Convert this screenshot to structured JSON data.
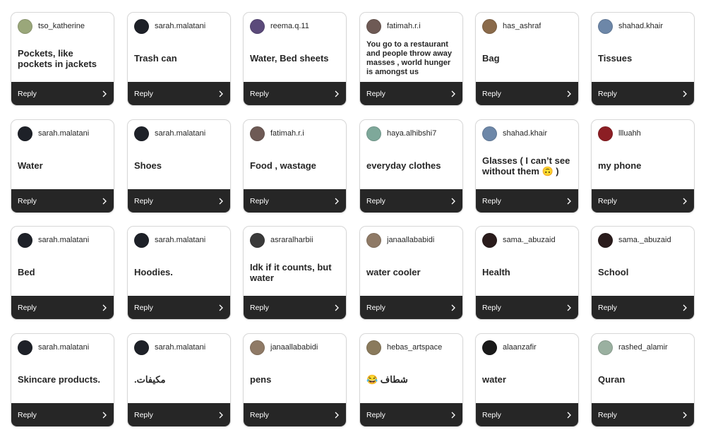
{
  "reply_label": "Reply",
  "cards": [
    {
      "user": "tso_katherine",
      "answer": "Pockets, like pockets in jackets",
      "avatar_color": "#9aa77a"
    },
    {
      "user": "sarah.malatani",
      "answer": "Trash can",
      "avatar_color": "#1e2128"
    },
    {
      "user": "reema.q.11",
      "answer": "Water, Bed sheets",
      "avatar_color": "#5b4a7a"
    },
    {
      "user": "fatimah.r.i",
      "answer": "You go to a restaurant and people throw away masses , world hunger is amongst us",
      "avatar_color": "#6e5a55"
    },
    {
      "user": "has_ashraf",
      "answer": "Bag",
      "avatar_color": "#8a6a4a"
    },
    {
      "user": "shahad.khair",
      "answer": "Tissues",
      "avatar_color": "#6d87a8"
    },
    {
      "user": "sarah.malatani",
      "answer": "Water",
      "avatar_color": "#1e2128"
    },
    {
      "user": "sarah.malatani",
      "answer": "Shoes",
      "avatar_color": "#1e2128"
    },
    {
      "user": "fatimah.r.i",
      "answer": "Food , wastage",
      "avatar_color": "#6e5a55"
    },
    {
      "user": "haya.alhibshi7",
      "answer": "everyday clothes",
      "avatar_color": "#7ea89a"
    },
    {
      "user": "shahad.khair",
      "answer": "Glasses ( I can’t see without them 🙃 )",
      "avatar_color": "#6d87a8"
    },
    {
      "user": "llluahh",
      "answer": "my phone",
      "avatar_color": "#8c1e24"
    },
    {
      "user": "sarah.malatani",
      "answer": "Bed",
      "avatar_color": "#1e2128"
    },
    {
      "user": "sarah.malatani",
      "answer": "Hoodies.",
      "avatar_color": "#1e2128"
    },
    {
      "user": "asraralharbii",
      "answer": "Idk if it counts, but water",
      "avatar_color": "#3a3a3a"
    },
    {
      "user": "janaallababidi",
      "answer": "water cooler",
      "avatar_color": "#8f7a66"
    },
    {
      "user": "sama._abuzaid",
      "answer": "Health",
      "avatar_color": "#2a1c1c"
    },
    {
      "user": "sama._abuzaid",
      "answer": "School",
      "avatar_color": "#2a1c1c"
    },
    {
      "user": "sarah.malatani",
      "answer": "Skincare products.",
      "avatar_color": "#1e2128"
    },
    {
      "user": "sarah.malatani",
      "answer": "مكيفات.",
      "avatar_color": "#1e2128"
    },
    {
      "user": "janaallababidi",
      "answer": "pens",
      "avatar_color": "#8f7a66"
    },
    {
      "user": "hebas_artspace",
      "answer": "شطاف 😂",
      "avatar_color": "#8a7a5c"
    },
    {
      "user": "alaanzafir",
      "answer": "water",
      "avatar_color": "#1a1a1a"
    },
    {
      "user": "rashed_alamir",
      "answer": "Quran",
      "avatar_color": "#9ab0a0"
    }
  ]
}
